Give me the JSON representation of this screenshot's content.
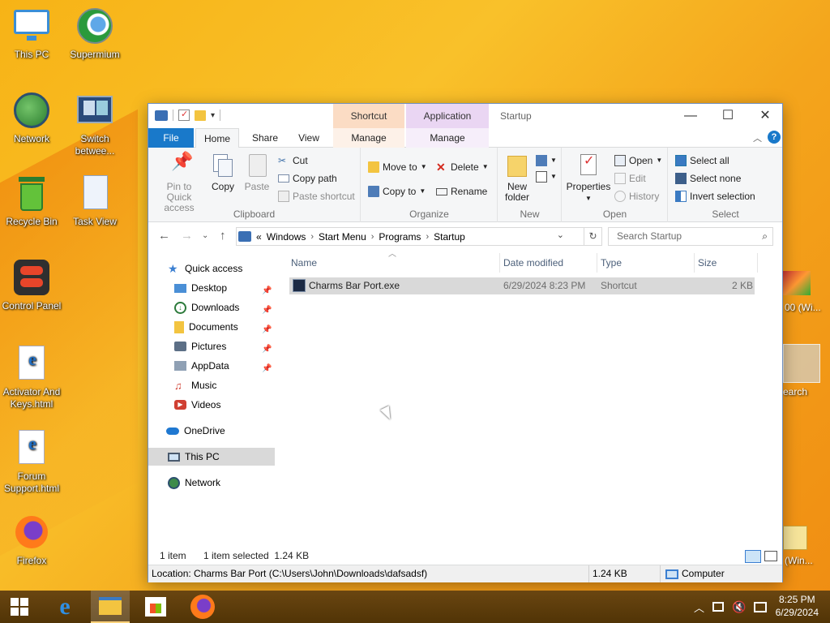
{
  "desktop": {
    "icons": [
      {
        "label": "This PC"
      },
      {
        "label": "Supermium"
      },
      {
        "label": "Network"
      },
      {
        "label": "Switch betwee..."
      },
      {
        "label": "Recycle Bin"
      },
      {
        "label": "Task View"
      },
      {
        "label": "Control Panel"
      },
      {
        "label": "Activator And Keys.html"
      },
      {
        "label": "Forum Support.html"
      },
      {
        "label": "Firefox"
      }
    ],
    "peek_labels": [
      "00 (Wi...",
      "earch",
      "(Win..."
    ]
  },
  "window": {
    "title": "Startup",
    "contextual_groups": [
      "Shortcut Tools",
      "Application Tools"
    ],
    "tabs": {
      "file": "File",
      "home": "Home",
      "share": "Share",
      "view": "View",
      "manage1": "Manage",
      "manage2": "Manage"
    },
    "ribbon": {
      "clipboard": {
        "label": "Clipboard",
        "pin": "Pin to Quick access",
        "copy": "Copy",
        "paste": "Paste",
        "cut": "Cut",
        "copy_path": "Copy path",
        "paste_shortcut": "Paste shortcut"
      },
      "organize": {
        "label": "Organize",
        "move_to": "Move to",
        "copy_to": "Copy to",
        "delete": "Delete",
        "rename": "Rename"
      },
      "new": {
        "label": "New",
        "new_folder": "New folder"
      },
      "open": {
        "label": "Open",
        "properties": "Properties",
        "open": "Open",
        "edit": "Edit",
        "history": "History"
      },
      "select": {
        "label": "Select",
        "select_all": "Select all",
        "select_none": "Select none",
        "invert": "Invert selection"
      }
    },
    "address": {
      "prefix": "«",
      "crumbs": [
        "Windows",
        "Start Menu",
        "Programs",
        "Startup"
      ],
      "search_placeholder": "Search Startup"
    },
    "nav": {
      "quick_access": "Quick access",
      "items": [
        {
          "label": "Desktop",
          "pinned": true
        },
        {
          "label": "Downloads",
          "pinned": true
        },
        {
          "label": "Documents",
          "pinned": true
        },
        {
          "label": "Pictures",
          "pinned": true
        },
        {
          "label": "AppData",
          "pinned": true
        },
        {
          "label": "Music",
          "pinned": false
        },
        {
          "label": "Videos",
          "pinned": false
        }
      ],
      "onedrive": "OneDrive",
      "this_pc": "This PC",
      "network": "Network"
    },
    "columns": {
      "name": "Name",
      "date": "Date modified",
      "type": "Type",
      "size": "Size"
    },
    "files": [
      {
        "name": "Charms Bar Port.exe",
        "date": "6/29/2024 8:23 PM",
        "type": "Shortcut",
        "size": "2 KB"
      }
    ],
    "status": {
      "count": "1 item",
      "selected": "1 item selected  1.24 KB"
    },
    "infobar": {
      "location": "Location: Charms Bar Port (C:\\Users\\John\\Downloads\\dafsadsf)",
      "size": "1.24 KB",
      "computer": "Computer"
    }
  },
  "taskbar": {
    "clock_time": "8:25 PM",
    "clock_date": "6/29/2024"
  }
}
